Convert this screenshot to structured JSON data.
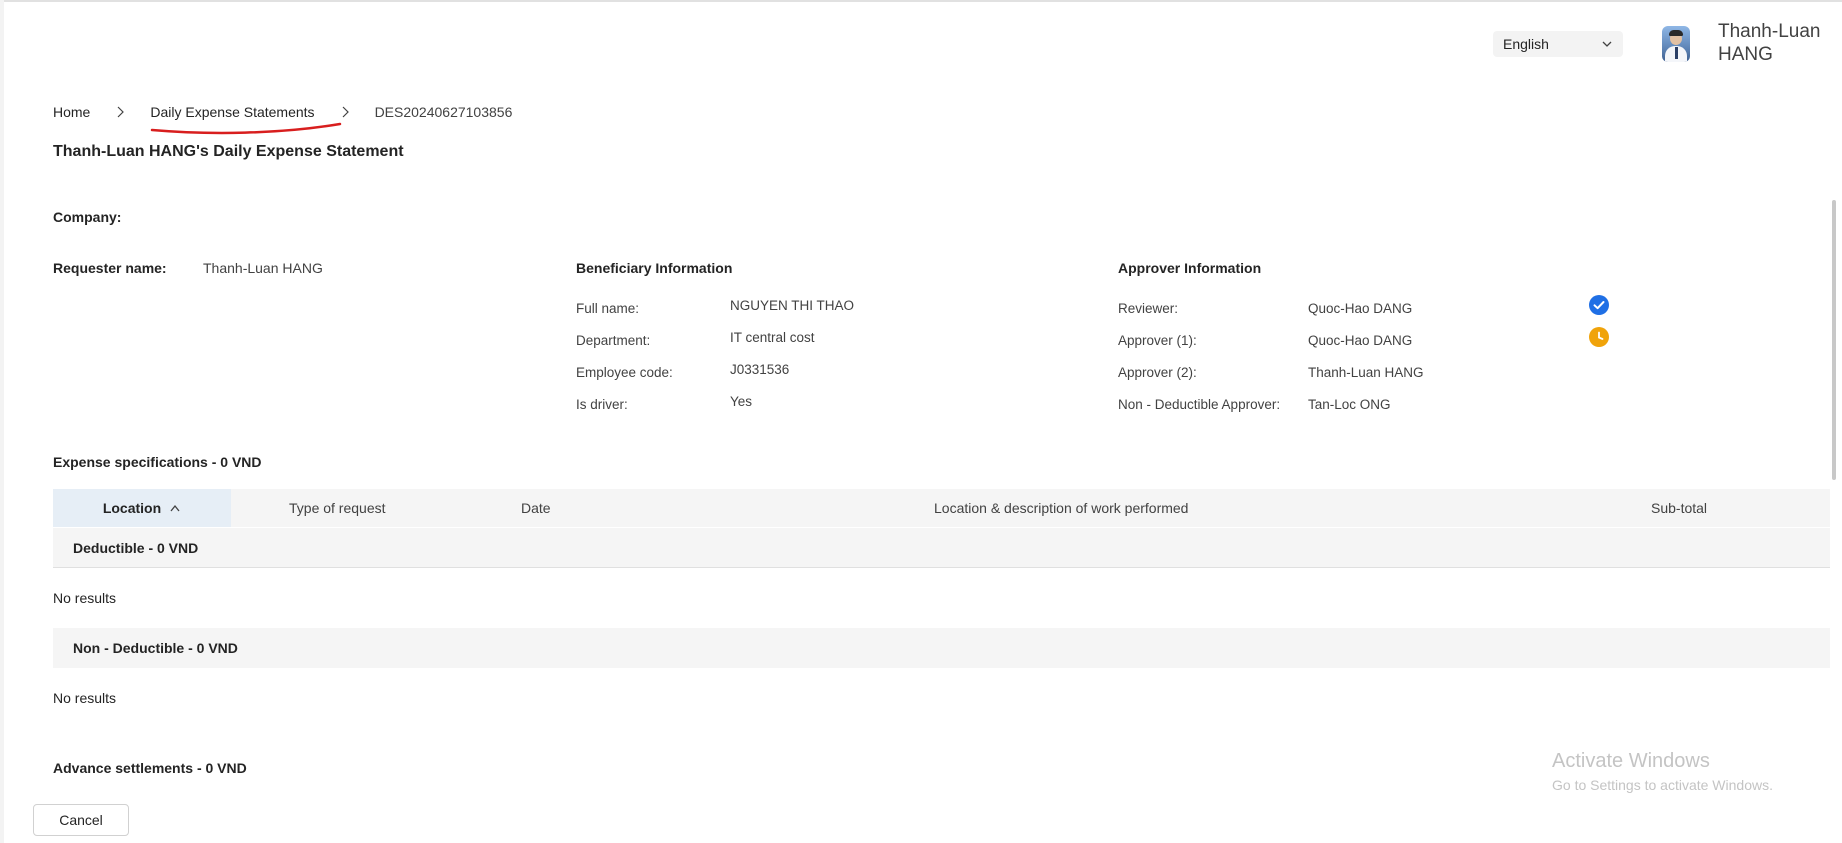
{
  "header": {
    "language": "English",
    "user_name": "Thanh-Luan HANG"
  },
  "breadcrumb": {
    "home": "Home",
    "list": "Daily Expense Statements",
    "current": "DES20240627103856"
  },
  "page_title": "Thanh-Luan HANG's Daily Expense Statement",
  "company_label": "Company:",
  "requester": {
    "label": "Requester name:",
    "value": "Thanh-Luan HANG"
  },
  "beneficiary": {
    "title": "Beneficiary Information",
    "rows": [
      {
        "label": "Full name:",
        "value": "NGUYEN THI THAO"
      },
      {
        "label": "Department:",
        "value": "IT central cost"
      },
      {
        "label": "Employee code:",
        "value": "J0331536"
      },
      {
        "label": "Is driver:",
        "value": "Yes"
      }
    ]
  },
  "approver": {
    "title": "Approver Information",
    "rows": [
      {
        "label": "Reviewer:",
        "value": "Quoc-Hao DANG",
        "status": "approved",
        "status_color": "#1f6fe5",
        "icon": "check-circle-icon"
      },
      {
        "label": "Approver (1):",
        "value": "Quoc-Hao DANG",
        "status": "pending",
        "status_color": "#f0a30a",
        "icon": "clock-icon"
      },
      {
        "label": "Approver (2):",
        "value": "Thanh-Luan HANG"
      },
      {
        "label": "Non - Deductible Approver:",
        "value": "Tan-Loc ONG"
      }
    ]
  },
  "expense": {
    "title": "Expense specifications - 0 VND",
    "columns": [
      "Location",
      "Type of request",
      "Date",
      "Location & description of work performed",
      "Sub-total"
    ],
    "sorted_column": "Location",
    "sort_direction": "ascending",
    "groups": [
      {
        "title": "Deductible - 0 VND",
        "empty_text": "No results"
      },
      {
        "title": "Non - Deductible - 0 VND",
        "empty_text": "No results"
      }
    ]
  },
  "advance_title": "Advance settlements - 0 VND",
  "cancel_label": "Cancel",
  "watermark": {
    "line1": "Activate Windows",
    "line2": "Go to Settings to activate Windows."
  },
  "colors": {
    "accent_underline": "#d81e1e",
    "approved": "#1f6fe5",
    "pending": "#f0a30a"
  }
}
